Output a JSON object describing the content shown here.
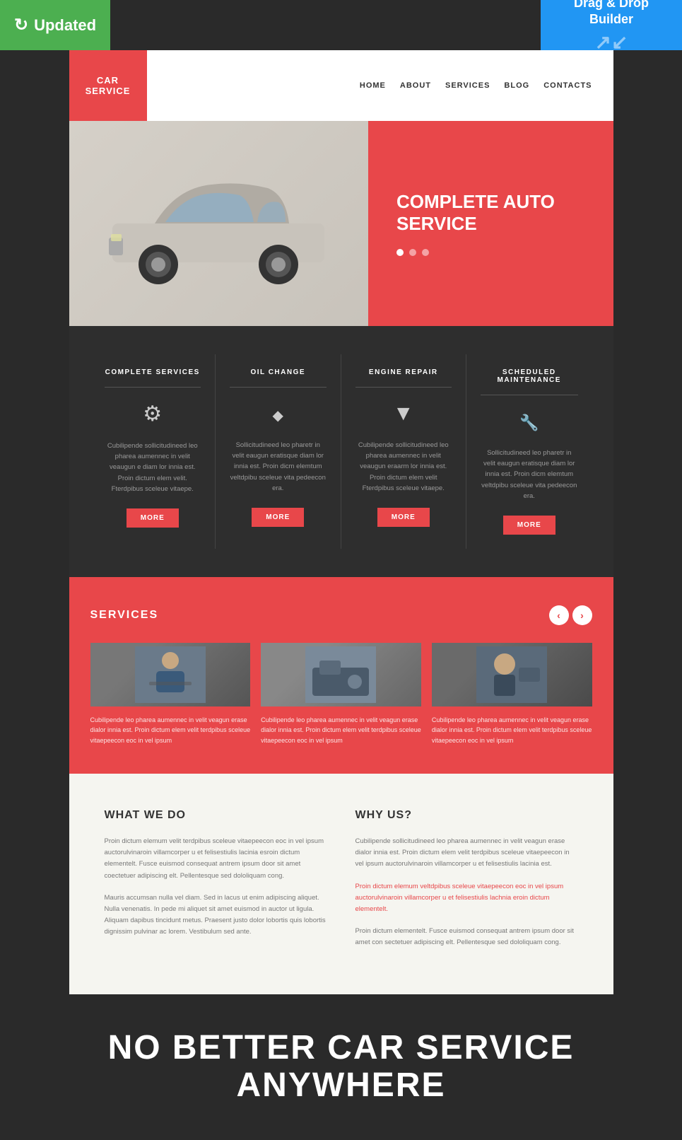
{
  "badges": {
    "updated_label": "Updated",
    "drag_drop_line1": "Drag & Drop",
    "drag_drop_line2": "Builder"
  },
  "header": {
    "logo_line1": "CAR",
    "logo_line2": "SERVICE",
    "nav": {
      "home": "HOME",
      "about": "ABOUT",
      "services": "SERVICES",
      "blog": "BLOG",
      "contacts": "CONTACTS"
    }
  },
  "hero": {
    "title_line1": "COMPLETE AUTO",
    "title_line2": "SERVICE"
  },
  "services_grid": {
    "columns": [
      {
        "title": "COMPLETE SERVICES",
        "icon": "gear",
        "desc": "Cubilipende sollicitudineed leo pharea aumennec in velit veaugun e diam lor innia est. Proin dictum elem velit. Fterdpibus sceleue vitaepe.",
        "btn": "MORE"
      },
      {
        "title": "OIL CHANGE",
        "icon": "drop",
        "desc": "Sollicitudineed leo pharetr in velit eaugun eratisque diam lor innia est. Proin dicm elemtum veltdpibu sceleue vita pedeecon era.",
        "btn": "MORE"
      },
      {
        "title": "ENGINE REPAIR",
        "icon": "filter",
        "desc": "Cubilipende sollicitudineed leo pharea aumennec in velit veaugun eraarm lor innia est. Proin dictum elem velit Fterdpibus sceleue vitaepe.",
        "btn": "MORE"
      },
      {
        "title": "SCHEDULED MAINTENANCE",
        "icon": "wrench",
        "desc": "Sollicitudineed leo pharetr in velit eaugun eratisque diam lor innia est. Proin dicm elemtum veltdpibu sceleue vita pedeecon era.",
        "btn": "MORE"
      }
    ]
  },
  "services_carousel": {
    "title": "SERVICES",
    "items": [
      {
        "desc": "Cubilipende leo pharea aumennec in velit veagun erase dialor innia est. Proin dictum elem velit terdpibus sceleue vitaepeecon eoc in vel ipsum"
      },
      {
        "desc": "Cubilipende leo pharea aumennec in velit veagun erase dialor innia est. Proin dictum elem velit terdpibus sceleue vitaepeecon eoc in vel ipsum"
      },
      {
        "desc": "Cubilipende leo pharea aumennec in velit veagun erase dialor innia est. Proin dictum elem velit terdpibus sceleue vitaepeecon eoc in vel ipsum"
      }
    ]
  },
  "about": {
    "what_we_do": {
      "title": "WHAT WE DO",
      "para1": "Proin dictum elemum velit terdpibus sceleue vitaepeecon eoc in vel ipsum auctorulvinaroin villamcorper u et felisestiulis lacinia esroin dictum elementelt. Fusce euismod consequat antrem ipsum door sit amet coectetuer adipiscing elt. Pellentesque sed dololiquam cong.",
      "para2": "Mauris accumsan nulla vel diam. Sed in lacus ut enim adipiscing aliquet. Nulla venenatis. In pede mi aliquet sit amet euismod in auctor ut ligula. Aliquam dapibus tincidunt metus. Praesent justo dolor lobortis quis lobortis dignissim pulvinar ac lorem. Vestibulum sed ante."
    },
    "why_us": {
      "title": "WHY US?",
      "para1": "Cubilipende sollicitudineed leo pharea aumennec in velit veagun erase dialor innia est. Proin dictum elem velit terdpibus sceleue vitaepeecon in vel ipsum auctorulvinaroin villamcorper u et felisestiulis lacinia est.",
      "para_highlight": "Proin dictum elemum veltdpibus sceleue vitaepeecon eoc in vel ipsum auctorulvinaroin villamcorper u et felisestiulis lachnia eroin dictum elementelt.",
      "para2": "Proin dictum elementelt. Fusce euismod consequat antrem ipsum door sit amet con sectetuer adipiscing elt. Pellentesque sed dololiquam cong."
    }
  },
  "bottom": {
    "line1": "NO BETTER CAR SERVICE",
    "line2": "ANYWHERE"
  }
}
